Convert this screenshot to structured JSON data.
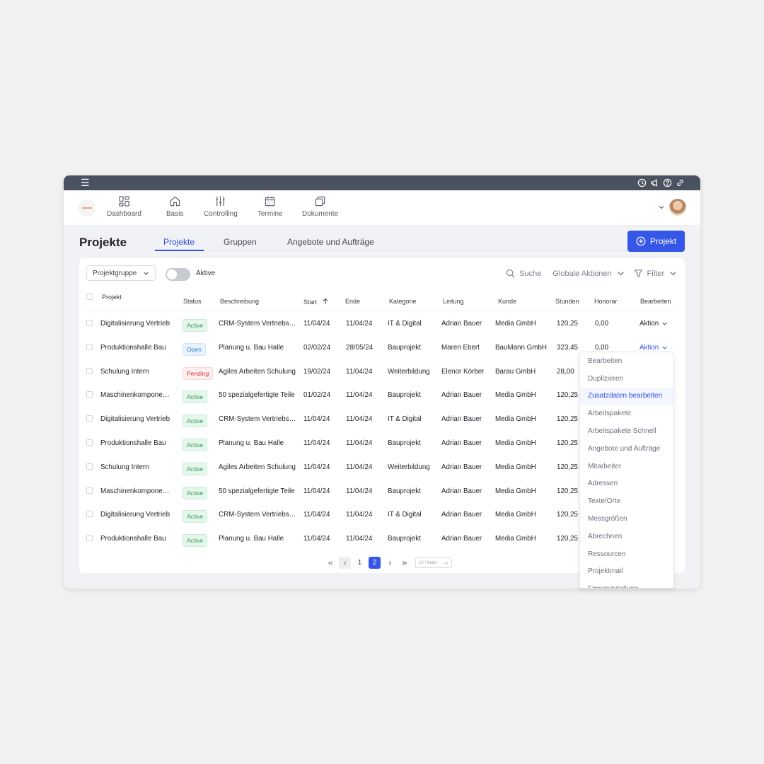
{
  "topbar": {
    "menu_icon": "hamburger-icon",
    "sys_icons": [
      "clock-icon",
      "megaphone-icon",
      "help-icon",
      "link-icon"
    ]
  },
  "nav": {
    "items": [
      {
        "label": "Dashboard",
        "icon": "dashboard-icon"
      },
      {
        "label": "Basis",
        "icon": "home-icon"
      },
      {
        "label": "Controlling",
        "icon": "sliders-icon"
      },
      {
        "label": "Termine",
        "icon": "calendar-icon"
      },
      {
        "label": "Dokumente",
        "icon": "documents-icon"
      }
    ]
  },
  "page": {
    "title": "Projekte",
    "tabs": [
      "Projekte",
      "Gruppen",
      "Angebote und Aufträge"
    ],
    "new_button": "Projekt"
  },
  "filters": {
    "group_select": "Projektgruppe",
    "toggle_label": "Aktive",
    "search": "Suche",
    "global_actions": "Globale Aktionen",
    "filter": "Filter"
  },
  "table": {
    "headers": [
      "Projekt",
      "Status",
      "Beschreibung",
      "Start",
      "Ende",
      "Kategorie",
      "Leitung",
      "Kunde",
      "Stunden",
      "Honorar",
      "Bearbeiten"
    ],
    "rows": [
      [
        "Digitalisierung Vertrieb",
        "Active",
        "CRM-System Vertriebsteam",
        "11/04/24",
        "11/04/24",
        "IT & Digital",
        "Adrian Bauer",
        "Media GmbH",
        "120,25",
        "0,00",
        "Aktion"
      ],
      [
        "Produktionshalle Bau",
        "Open",
        "Planung u. Bau Halle",
        "02/02/24",
        "28/05/24",
        "Bauprojekt",
        "Maren Ebert",
        "BauMann GmbH",
        "323,45",
        "0,00",
        "Aktion"
      ],
      [
        "Schulung Intern",
        "Pending",
        "Agiles Arbeiten Schulung",
        "19/02/24",
        "11/04/24",
        "Weiterbildung",
        "Elenor Körber",
        "Barau GmbH",
        "28,00",
        "",
        ""
      ],
      [
        "Maschinenkomponenten",
        "Active",
        "50 spezialgefertigte Teile",
        "01/02/24",
        "11/04/24",
        "Bauprojekt",
        "Adrian Bauer",
        "Media GmbH",
        "120,25",
        "",
        ""
      ],
      [
        "Digitalisierung Vertrieb",
        "Active",
        "CRM-System Vertriebsteam",
        "11/04/24",
        "11/04/24",
        "IT & Digital",
        "Adrian Bauer",
        "Media GmbH",
        "120,25",
        "",
        ""
      ],
      [
        "Produktionshalle Bau",
        "Active",
        "Planung u. Bau Halle",
        "11/04/24",
        "11/04/24",
        "Bauprojekt",
        "Adrian Bauer",
        "Media GmbH",
        "120,25",
        "",
        ""
      ],
      [
        "Schulung Intern",
        "Active",
        "Agiles Arbeiten Schulung",
        "11/04/24",
        "11/04/24",
        "Weiterbildung",
        "Adrian Bauer",
        "Media GmbH",
        "120,25",
        "",
        ""
      ],
      [
        "Maschinenkomponenten",
        "Active",
        "50 spezialgefertigte Teile",
        "11/04/24",
        "11/04/24",
        "Bauprojekt",
        "Adrian Bauer",
        "Media GmbH",
        "120,25",
        "",
        ""
      ],
      [
        "Digitalisierung Vertrieb",
        "Active",
        "CRM-System Vertriebsteam",
        "11/04/24",
        "11/04/24",
        "IT & Digital",
        "Adrian Bauer",
        "Media GmbH",
        "120,25",
        "",
        ""
      ],
      [
        "Produktionshalle Bau",
        "Active",
        "Planung u. Bau Halle",
        "11/04/24",
        "11/04/24",
        "Bauprojekt",
        "Adrian Bauer",
        "Media GmbH",
        "120,25",
        "",
        ""
      ]
    ]
  },
  "pagination": {
    "pages": [
      "1",
      "2"
    ],
    "current": "2",
    "page_size": "10 / Seite"
  },
  "action_menu": {
    "items": [
      "Bearbeiten",
      "Duplizieren",
      "Zusatzdaten bearbeiten",
      "Arbeitspakete",
      "Arbeitspakete Schnell",
      "Angebote und Aufträge",
      "Mitarbeiter",
      "Adressen",
      "Texte/Orte",
      "Messgrößen",
      "Abrechnen",
      "Ressourcen",
      "Projektmail",
      "Firmenzuteilung"
    ],
    "selected": "Zusatzdaten bearbeiten"
  },
  "colors": {
    "accent": "#3556e6",
    "topbar": "#4a5260",
    "active": "#22a04b",
    "open": "#2f7bd8",
    "pending": "#d8282f"
  }
}
